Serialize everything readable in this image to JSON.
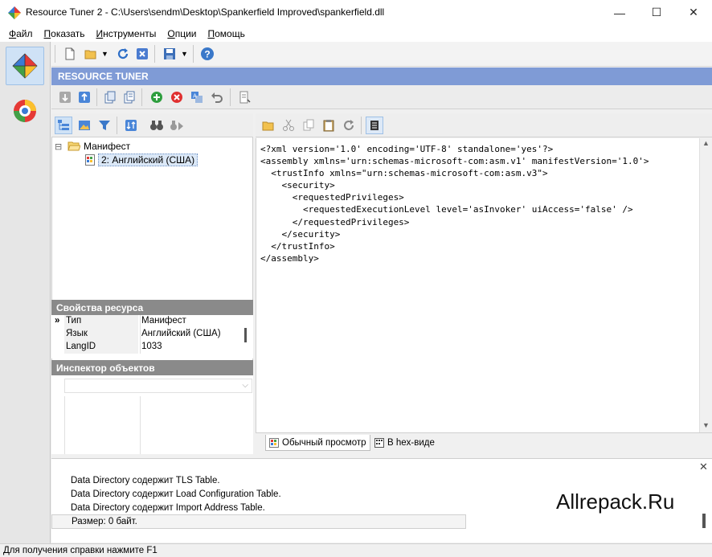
{
  "window": {
    "title": "Resource Tuner 2 - C:\\Users\\sendm\\Desktop\\Spankerfield Improved\\spankerfield.dll",
    "minimize": "—",
    "maximize": "☐",
    "close": "✕"
  },
  "menu": [
    {
      "accel": "Ф",
      "rest": "айл"
    },
    {
      "accel": "П",
      "rest": "оказать"
    },
    {
      "accel": "И",
      "rest": "нструменты"
    },
    {
      "accel": "О",
      "rest": "пции"
    },
    {
      "accel": "П",
      "rest": "омощь"
    }
  ],
  "banner": "RESOURCE TUNER",
  "tree": {
    "root_label": "Манифест",
    "child_label": "2: Английский (США)",
    "expand_glyph": "⊟"
  },
  "properties": {
    "header": "Свойства ресурса",
    "rows": [
      {
        "key": "Тип",
        "value": "Манифест"
      },
      {
        "key": "Язык",
        "value": "Английский (США)"
      },
      {
        "key": "LangID",
        "value": "1033"
      }
    ]
  },
  "inspector": {
    "header": "Инспектор объектов"
  },
  "editor": {
    "code": "<?xml version='1.0' encoding='UTF-8' standalone='yes'?>\n<assembly xmlns='urn:schemas-microsoft-com:asm.v1' manifestVersion='1.0'>\n  <trustInfo xmlns=\"urn:schemas-microsoft-com:asm.v3\">\n    <security>\n      <requestedPrivileges>\n        <requestedExecutionLevel level='asInvoker' uiAccess='false' />\n      </requestedPrivileges>\n    </security>\n  </trustInfo>\n</assembly>"
  },
  "tabs": {
    "normal_view": "Обычный просмотр",
    "hex_view": "B hex-виде"
  },
  "log": {
    "lines": [
      "Data Directory содержит TLS Table.",
      "Data Directory содержит Load Configuration Table.",
      "Data Directory содержит Import Address Table."
    ],
    "size_line": "Размер: 0 байт.",
    "watermark": "Allrepack.Ru",
    "close": "✕"
  },
  "status": "Для получения справки нажмите F1",
  "colors": {
    "banner": "#7f9bd6",
    "section_header": "#8a8a8a",
    "selected_nav": "#cfe2f6"
  }
}
